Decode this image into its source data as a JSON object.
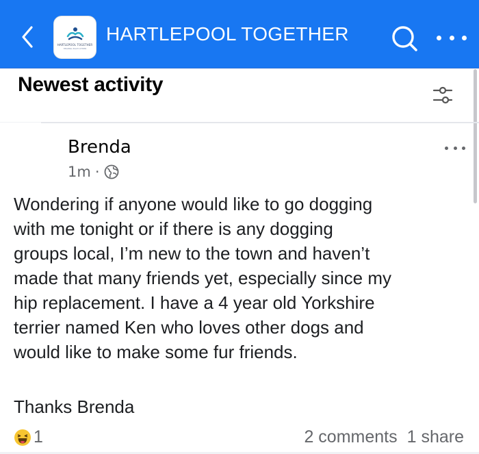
{
  "header": {
    "group_name": "HARTLEPOOL TOGETHER",
    "logo_text": "HARTLEPOOL TOGETHER",
    "logo_subtext": "HELPING EACH OTHER",
    "accent_color": "#1877f2",
    "icons": [
      "chevron-left-icon",
      "search-icon",
      "more-icon"
    ]
  },
  "feed": {
    "section_title": "Newest activity",
    "filter_icon": "sliders-icon"
  },
  "post": {
    "author": "Brenda",
    "time": "1m",
    "separator": "·",
    "privacy_icon": "globe-icon",
    "body_lines": [
      "Wondering if anyone would like to go dogging",
      "with me tonight or if there is any dogging",
      "groups local, I’m new to the town and haven’t",
      "made that many friends yet, especially since my",
      "hip replacement. I have a 4 year old Yorkshire",
      "terrier named Ken who loves other dogs and",
      "would like to make some fur friends."
    ],
    "signoff": "Thanks Brenda",
    "reaction_icon": "haha-emoji-icon",
    "reaction_count": "1",
    "comments": "2 comments",
    "shares": "1 share"
  }
}
